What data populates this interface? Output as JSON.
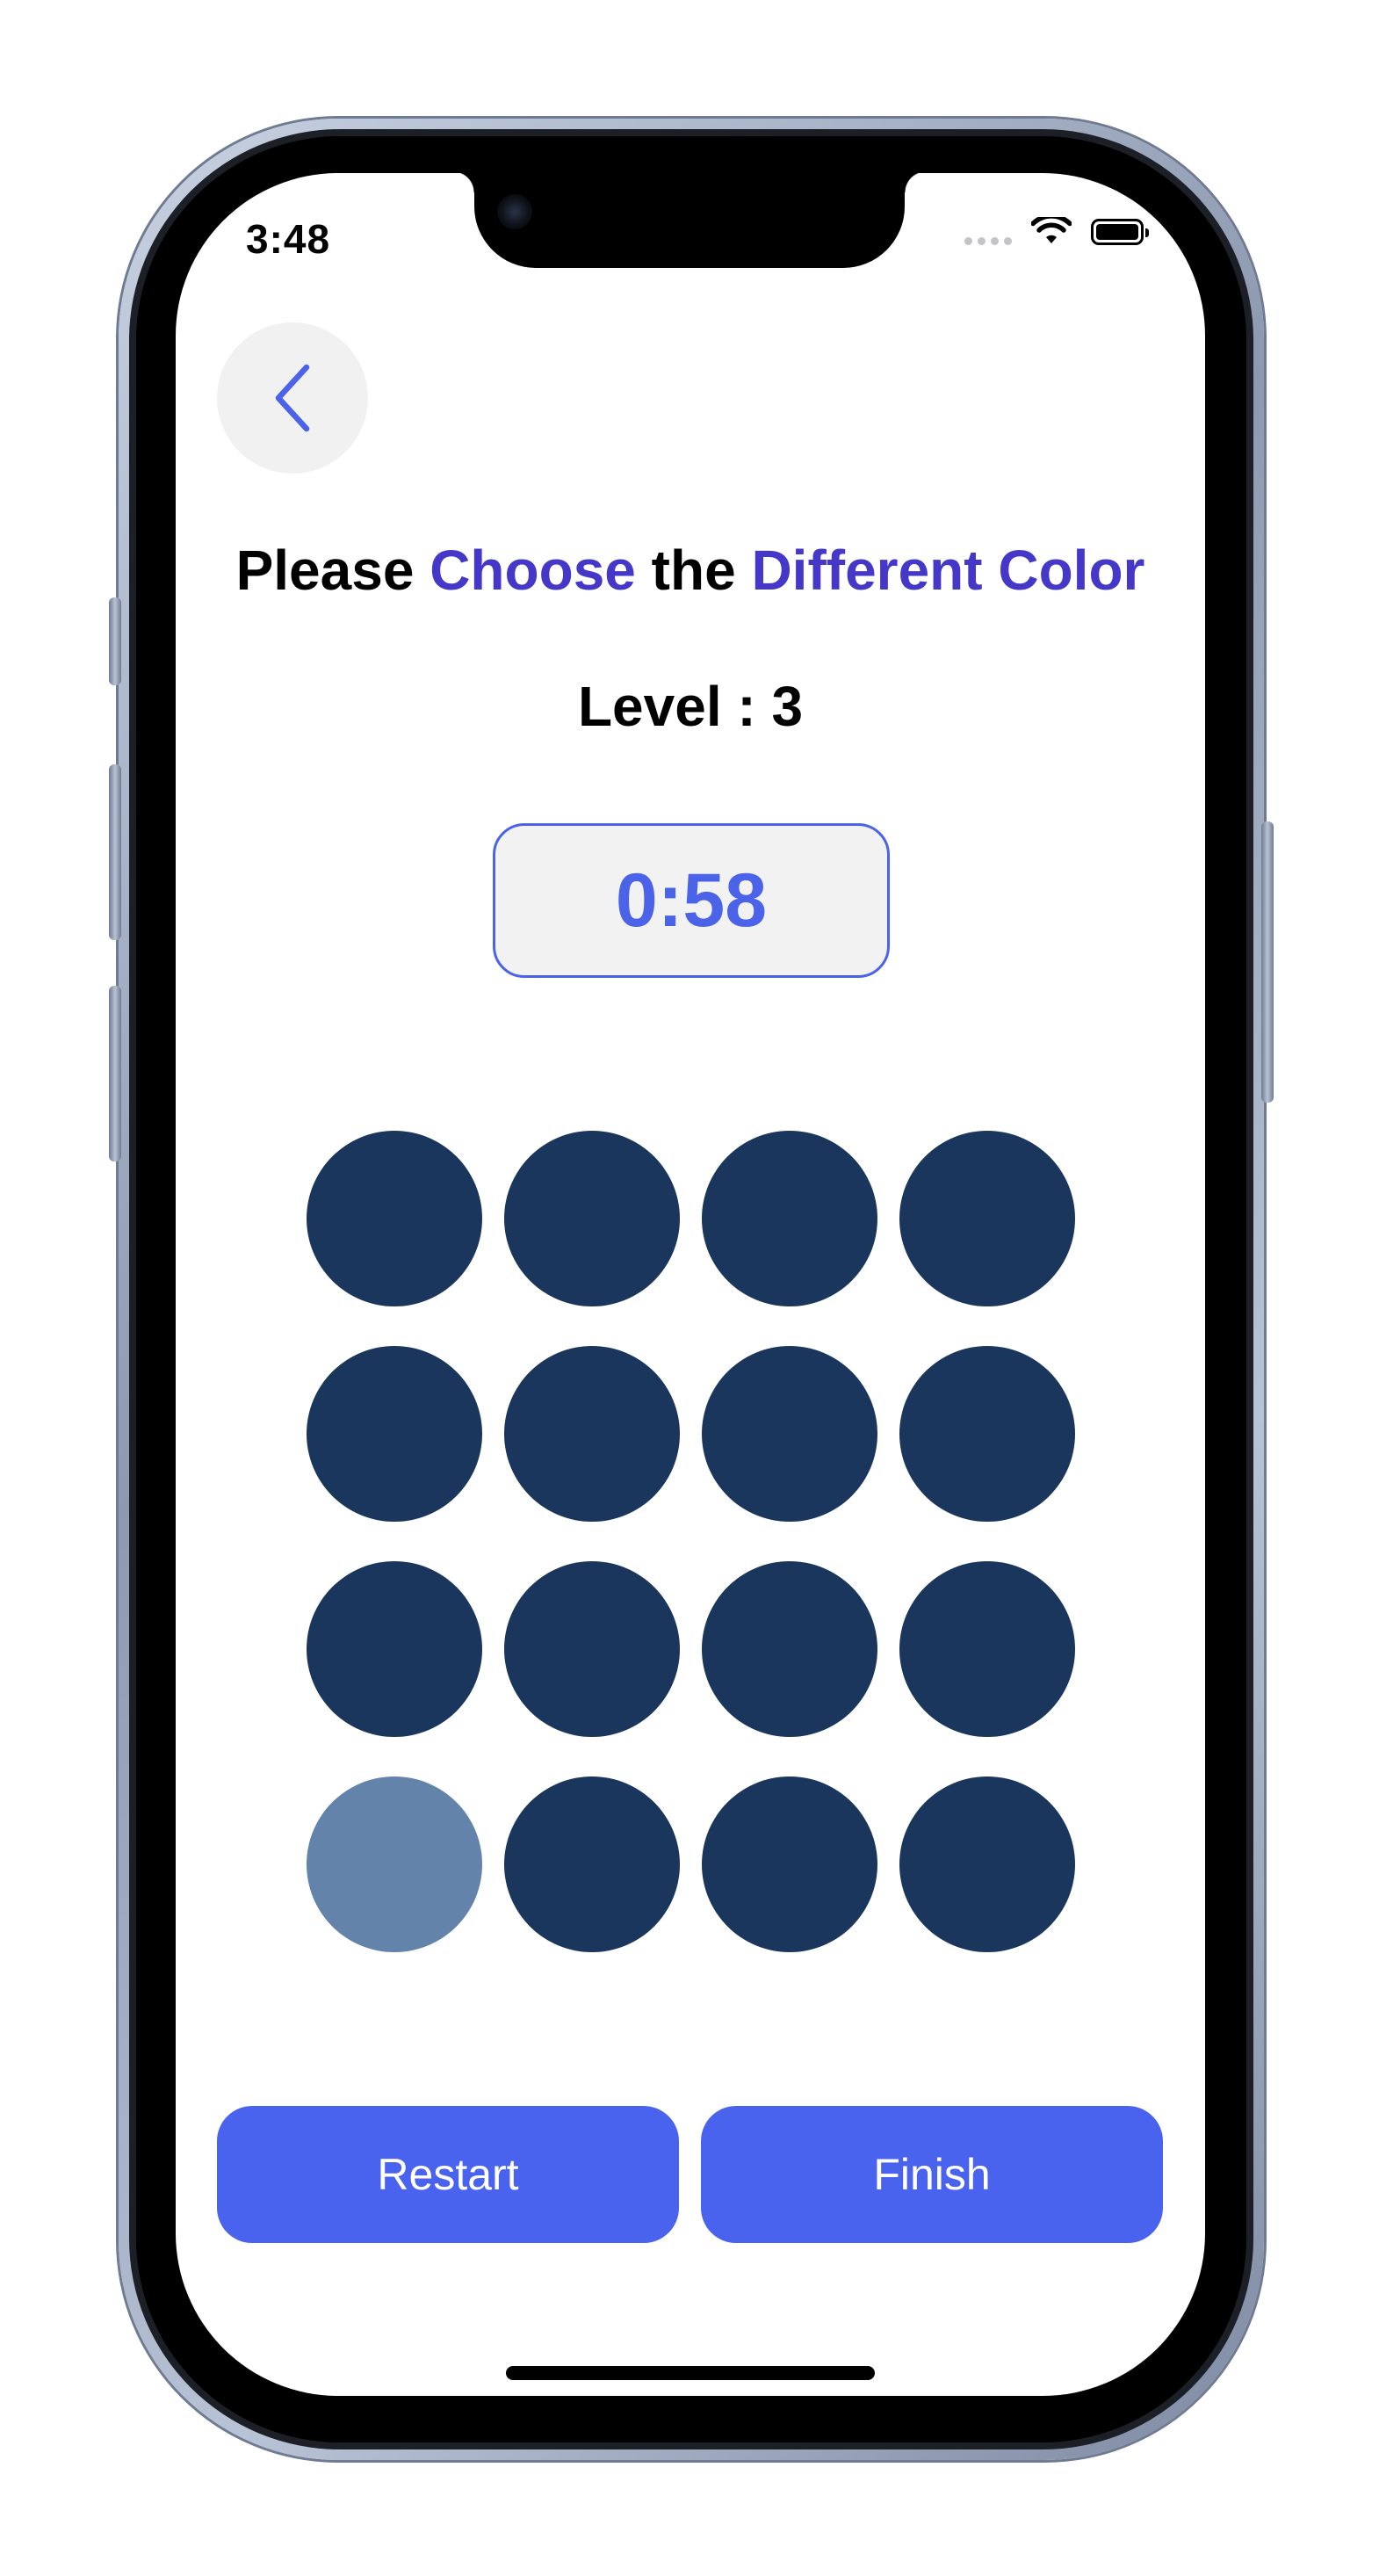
{
  "status_bar": {
    "time": "3:48",
    "icons": [
      "signal-dots-icon",
      "wifi-icon",
      "battery-icon"
    ]
  },
  "header": {
    "back_icon": "chevron-left-icon"
  },
  "title": {
    "part1": "Please ",
    "part2": "Choose",
    "part3": " the ",
    "part4": "Different Color"
  },
  "level_text": "Level : 3",
  "timer": "0:58",
  "grid": {
    "rows": 4,
    "columns": 4,
    "base_color": "#1a365d",
    "odd_color": "#6383ab",
    "odd_index": 12
  },
  "buttons": {
    "restart": "Restart",
    "finish": "Finish"
  },
  "colors": {
    "accent_text": "#4538c9",
    "primary": "#4a63ee"
  }
}
